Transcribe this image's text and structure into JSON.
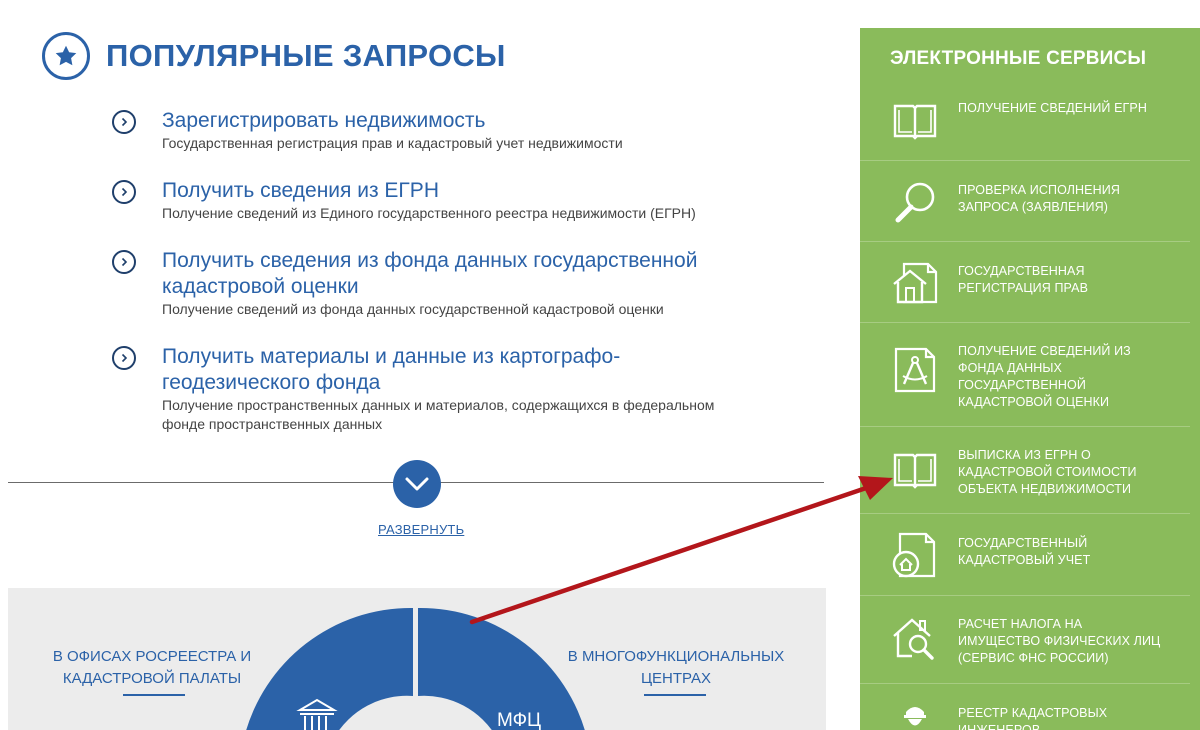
{
  "popular": {
    "title": "ПОПУЛЯРНЫЕ ЗАПРОСЫ",
    "icon": "star-icon",
    "requests": [
      {
        "title": "Зарегистрировать недвижимость",
        "title2": "",
        "desc": "Государственная регистрация прав и кадастровый учет недвижимости",
        "desc2": ""
      },
      {
        "title": "Получить сведения из ЕГРН",
        "title2": "",
        "desc": "Получение сведений из Единого государственного реестра недвижимости (ЕГРН)",
        "desc2": ""
      },
      {
        "title": "Получить сведения из фонда данных государственной",
        "title2": "кадастровой оценки",
        "desc": "Получение сведений из фонда данных государственной кадастровой оценки",
        "desc2": ""
      },
      {
        "title": "Получить материалы и данные из картографо-",
        "title2": "геодезического фонда",
        "desc": "Получение пространственных данных и материалов, содержащихся в федеральном",
        "desc2": "фонде пространственных данных"
      }
    ],
    "expand_label": "РАЗВЕРНУТЬ"
  },
  "ways": {
    "left_line1": "В ОФИСАХ РОСРЕЕСТРА И",
    "left_line2": "КАДАСТРОВОЙ ПАЛАТЫ",
    "right_line1": "В МНОГОФУНКЦИОНАЛЬНЫХ",
    "right_line2": "ЦЕНТРАХ",
    "mfc_label": "МФЦ"
  },
  "services": {
    "title": "ЭЛЕКТРОННЫЕ СЕРВИСЫ",
    "items": [
      {
        "icon": "book-icon",
        "lines": [
          "Получение сведений ЕГРН",
          "",
          "",
          ""
        ]
      },
      {
        "icon": "magnifier-icon",
        "lines": [
          "Проверка исполнения",
          "запроса (заявления)",
          "",
          ""
        ]
      },
      {
        "icon": "house-document-icon",
        "lines": [
          "Государственная",
          "регистрация прав",
          "",
          ""
        ]
      },
      {
        "icon": "compass-document-icon",
        "lines": [
          "Получение сведений из",
          "фонда данных",
          "государственной",
          "кадастровой оценки"
        ]
      },
      {
        "icon": "book-icon",
        "lines": [
          "Выписка из ЕГРН о",
          "кадастровой стоимости",
          "объекта недвижимости",
          ""
        ]
      },
      {
        "icon": "home-document-icon",
        "lines": [
          "Государственный",
          "кадастровый учет",
          "",
          ""
        ]
      },
      {
        "icon": "house-search-icon",
        "lines": [
          "Расчет налога на",
          "имущество физических лиц",
          "(сервис ФНС России)",
          ""
        ]
      },
      {
        "icon": "engineer-icon",
        "lines": [
          "Реестр кадастровых",
          "инженеров",
          "",
          ""
        ]
      }
    ]
  },
  "colors": {
    "brand_blue": "#2b62a8",
    "services_green": "#8abb5b",
    "arrow_red": "#b3161b",
    "panel_grey": "#ececec"
  }
}
